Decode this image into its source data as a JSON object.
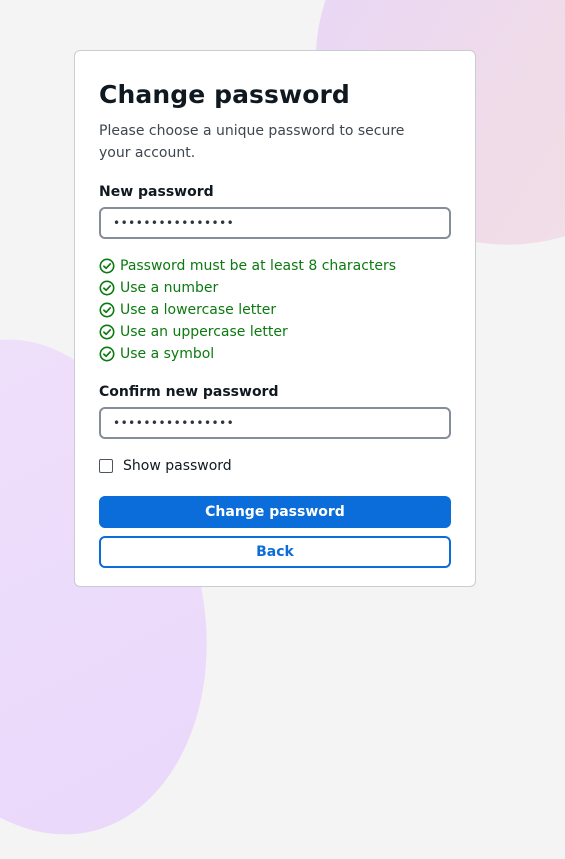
{
  "form": {
    "title": "Change password",
    "subtitle": "Please choose a unique password to secure your account.",
    "new_password": {
      "label": "New password",
      "value": "••••••••••••••••"
    },
    "rules": [
      {
        "text": "Password must be at least 8 characters",
        "met": true,
        "icon": "check-circle-icon"
      },
      {
        "text": "Use a number",
        "met": true,
        "icon": "check-circle-icon"
      },
      {
        "text": "Use a lowercase letter",
        "met": true,
        "icon": "check-circle-icon"
      },
      {
        "text": "Use an uppercase letter",
        "met": true,
        "icon": "check-circle-icon"
      },
      {
        "text": "Use a symbol",
        "met": true,
        "icon": "check-circle-icon"
      }
    ],
    "confirm_password": {
      "label": "Confirm new password",
      "value": "••••••••••••••••"
    },
    "show_password": {
      "label": "Show password",
      "checked": false
    },
    "submit_label": "Change password",
    "back_label": "Back"
  },
  "colors": {
    "primary": "#0b6dd9",
    "success": "#0b7a10",
    "page_background": "#f4f4f4"
  }
}
